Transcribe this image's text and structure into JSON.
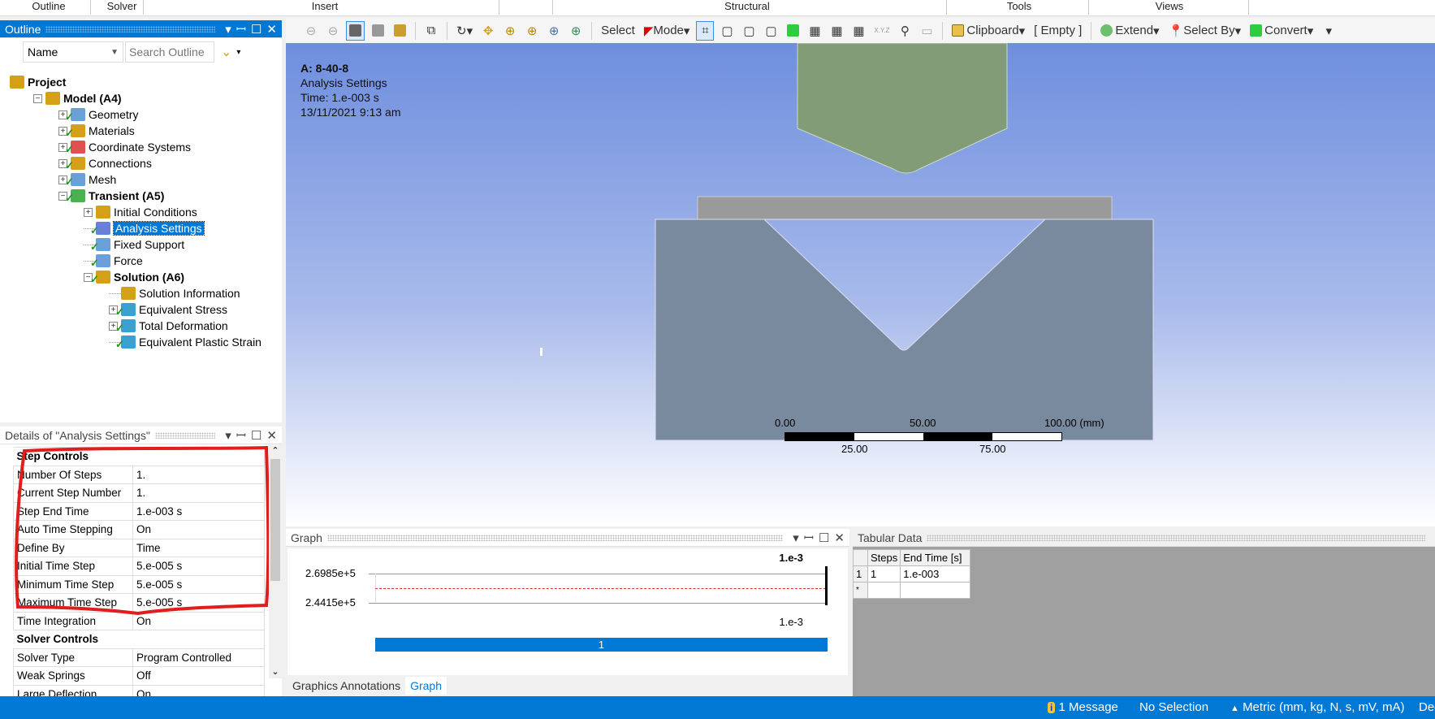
{
  "ribbon": {
    "groups": [
      "Outline",
      "Solver",
      "Insert",
      "Structural",
      "Tools",
      "Views"
    ]
  },
  "toolbar": {
    "select": "Select",
    "mode": "Mode",
    "clipboard": "Clipboard",
    "empty": "[ Empty ]",
    "extend": "Extend",
    "select_by": "Select By",
    "convert": "Convert",
    "xyz": "X.Y.Z"
  },
  "outline": {
    "title": "Outline",
    "filter": "Name",
    "search_placeholder": "Search Outline",
    "tree": [
      {
        "label": "Project",
        "level": 0,
        "bold": true,
        "color": "#d4a017"
      },
      {
        "label": "Model (A4)",
        "level": 1,
        "bold": true,
        "exp": "−",
        "color": "#d4a017"
      },
      {
        "label": "Geometry",
        "level": 2,
        "exp": "+",
        "check": true,
        "color": "#6a9fd8"
      },
      {
        "label": "Materials",
        "level": 2,
        "exp": "+",
        "check": true,
        "color": "#d4a017"
      },
      {
        "label": "Coordinate Systems",
        "level": 2,
        "exp": "+",
        "check": true,
        "color": "#e05050"
      },
      {
        "label": "Connections",
        "level": 2,
        "exp": "+",
        "check": true,
        "color": "#d4a017"
      },
      {
        "label": "Mesh",
        "level": 2,
        "exp": "+",
        "check": true,
        "color": "#6a9fd8"
      },
      {
        "label": "Transient (A5)",
        "level": 2,
        "bold": true,
        "exp": "−",
        "check": true,
        "color": "#4caf50"
      },
      {
        "label": "Initial Conditions",
        "level": 3,
        "exp": "+",
        "color": "#d4a017"
      },
      {
        "label": "Analysis Settings",
        "level": 3,
        "check": true,
        "selected": true,
        "color": "#6a7fd8"
      },
      {
        "label": "Fixed Support",
        "level": 3,
        "check": true,
        "color": "#6a9fd8"
      },
      {
        "label": "Force",
        "level": 3,
        "check": true,
        "color": "#6a9fd8"
      },
      {
        "label": "Solution (A6)",
        "level": 3,
        "bold": true,
        "exp": "−",
        "check": true,
        "color": "#d4a017"
      },
      {
        "label": "Solution Information",
        "level": 4,
        "color": "#d4a017"
      },
      {
        "label": "Equivalent Stress",
        "level": 4,
        "exp": "+",
        "check": true,
        "color": "#3aa0d0"
      },
      {
        "label": "Total Deformation",
        "level": 4,
        "exp": "+",
        "check": true,
        "color": "#3aa0d0"
      },
      {
        "label": "Equivalent Plastic Strain",
        "level": 4,
        "check": true,
        "color": "#3aa0d0"
      }
    ]
  },
  "details": {
    "title": "Details of \"Analysis Settings\"",
    "groups": [
      {
        "name": "Step Controls",
        "rows": [
          [
            "Number Of Steps",
            "1."
          ],
          [
            "Current Step Number",
            "1."
          ],
          [
            "Step End Time",
            "1.e-003 s"
          ],
          [
            "Auto Time Stepping",
            "On"
          ],
          [
            "Define By",
            "Time"
          ],
          [
            "Initial Time Step",
            "5.e-005 s"
          ],
          [
            "Minimum Time Step",
            "5.e-005 s"
          ],
          [
            "Maximum Time Step",
            "5.e-005 s"
          ],
          [
            "Time Integration",
            "On"
          ]
        ]
      },
      {
        "name": "Solver Controls",
        "rows": [
          [
            "Solver Type",
            "Program Controlled"
          ],
          [
            "Weak Springs",
            "Off"
          ],
          [
            "Large Deflection",
            "On"
          ]
        ]
      }
    ]
  },
  "viewport": {
    "title": "A: 8-40-8",
    "subtitle": "Analysis Settings",
    "time": "Time: 1.e-003 s",
    "date": "13/11/2021 9:13 am",
    "scale": {
      "top": [
        "0.00",
        "50.00",
        "100.00 (mm)"
      ],
      "bottom": [
        "25.00",
        "75.00"
      ]
    },
    "colors": {
      "punch": "#839c78",
      "plate": "#9a9a9a",
      "die": "#7a8a9e"
    }
  },
  "graph": {
    "title": "Graph",
    "y_max": "2.6985e+5",
    "y_min": "2.4415e+5",
    "x_top": "1.e-3",
    "x_bottom": "1.e-3",
    "step_bar": "1",
    "tabs": [
      "Graphics Annotations",
      "Graph"
    ]
  },
  "tabular": {
    "title": "Tabular Data",
    "headers": [
      "Steps",
      "End Time [s]"
    ],
    "rows": [
      [
        "1",
        "1",
        "1.e-003"
      ],
      [
        "*",
        "",
        ""
      ]
    ]
  },
  "status": {
    "messages": "1 Message",
    "selection": "No Selection",
    "units": "Metric (mm, kg, N, s, mV, mA)",
    "extra": "Deg"
  }
}
